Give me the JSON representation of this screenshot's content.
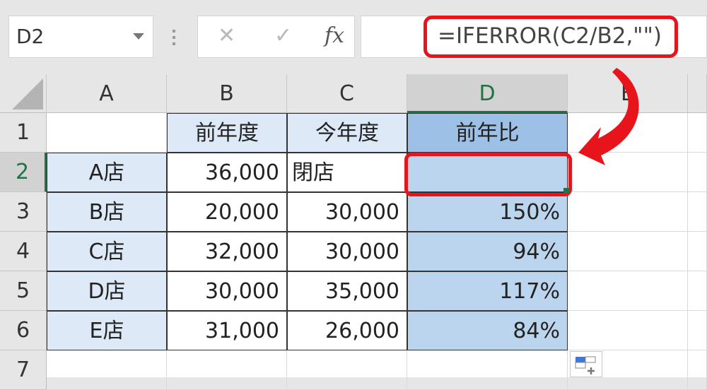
{
  "name_box": {
    "value": "D2"
  },
  "formula_bar": {
    "cancel_icon": "✕",
    "enter_icon": "✓",
    "fx_label": "fx",
    "formula": "=IFERROR(C2/B2,\"\")"
  },
  "columns": [
    "A",
    "B",
    "C",
    "D",
    "E"
  ],
  "rows": [
    "1",
    "2",
    "3",
    "4",
    "5",
    "6",
    "7"
  ],
  "selected_cell": "D2",
  "table": {
    "headers": [
      "",
      "前年度",
      "今年度",
      "前年比"
    ],
    "data": [
      [
        "A店",
        "36,000",
        "閉店",
        ""
      ],
      [
        "B店",
        "20,000",
        "30,000",
        "150%"
      ],
      [
        "C店",
        "32,000",
        "30,000",
        "94%"
      ],
      [
        "D店",
        "30,000",
        "35,000",
        "117%"
      ],
      [
        "E店",
        "31,000",
        "26,000",
        "84%"
      ]
    ]
  },
  "annotation": {
    "color": "#e8141c",
    "arrow": "curved-arrow pointing to D2"
  }
}
